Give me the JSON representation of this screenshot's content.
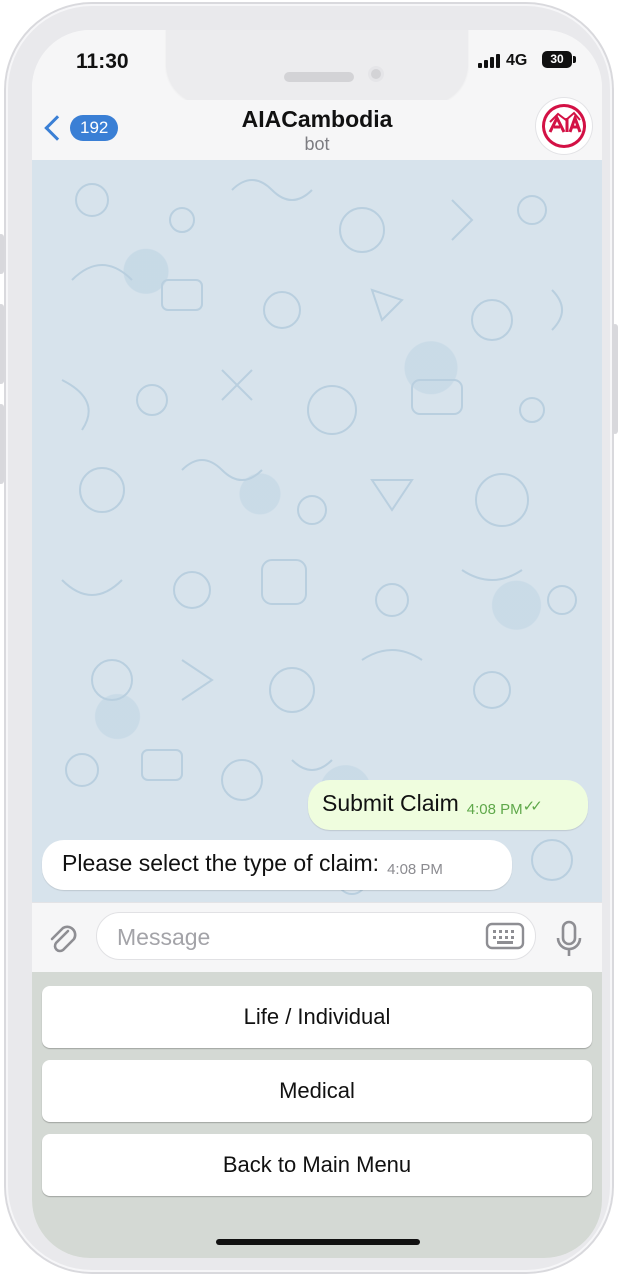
{
  "status_bar": {
    "time": "11:30",
    "network": "4G",
    "battery": "30"
  },
  "header": {
    "back_count": "192",
    "title": "AIACambodia",
    "subtitle": "bot",
    "avatar_icon": "aia-logo-icon"
  },
  "messages": [
    {
      "direction": "outgoing",
      "text": "Submit Claim",
      "time": "4:08 PM",
      "read": true
    },
    {
      "direction": "incoming",
      "text": "Please select the type of claim:",
      "time": "4:08 PM"
    }
  ],
  "input": {
    "placeholder": "Message",
    "attach_icon": "paperclip-icon",
    "keyboard_icon": "keyboard-icon",
    "mic_icon": "microphone-icon"
  },
  "reply_keyboard": {
    "buttons": [
      "Life / Individual",
      "Medical",
      "Back to Main Menu"
    ]
  },
  "colors": {
    "accent": "#3a7fd5",
    "outgoing_bubble": "#effdde",
    "brand_red": "#d31145"
  }
}
